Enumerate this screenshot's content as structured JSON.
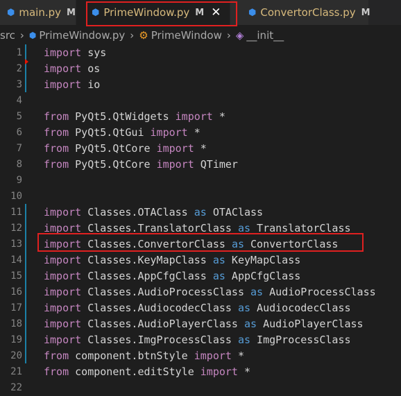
{
  "tabs": [
    {
      "name": "main.py",
      "badge": "M"
    },
    {
      "name": "PrimeWindow.py",
      "badge": "M",
      "close": "✕"
    },
    {
      "name": "ConvertorClass.py",
      "badge": "M"
    }
  ],
  "breadcrumb": {
    "folder": "src",
    "file": "PrimeWindow.py",
    "class_name": "PrimeWindow",
    "method": "__init__"
  },
  "colors": {
    "keyword_blue": "#569cd6",
    "keyword_purple": "#c586c0",
    "highlight_red": "#e02020"
  },
  "lines": [
    {
      "n": "1",
      "tokens": [
        [
          "kw2",
          "import"
        ],
        [
          "",
          " sys"
        ]
      ]
    },
    {
      "n": "2",
      "tokens": [
        [
          "kw2",
          "import"
        ],
        [
          "",
          " os"
        ]
      ]
    },
    {
      "n": "3",
      "tokens": [
        [
          "kw2",
          "import"
        ],
        [
          "",
          " io"
        ]
      ]
    },
    {
      "n": "4",
      "tokens": []
    },
    {
      "n": "5",
      "tokens": [
        [
          "kw2",
          "from"
        ],
        [
          "",
          " PyQt5.QtWidgets "
        ],
        [
          "kw2",
          "import"
        ],
        [
          "",
          " *"
        ]
      ]
    },
    {
      "n": "6",
      "tokens": [
        [
          "kw2",
          "from"
        ],
        [
          "",
          " PyQt5.QtGui "
        ],
        [
          "kw2",
          "import"
        ],
        [
          "",
          " *"
        ]
      ]
    },
    {
      "n": "7",
      "tokens": [
        [
          "kw2",
          "from"
        ],
        [
          "",
          " PyQt5.QtCore "
        ],
        [
          "kw2",
          "import"
        ],
        [
          "",
          " *"
        ]
      ]
    },
    {
      "n": "8",
      "tokens": [
        [
          "kw2",
          "from"
        ],
        [
          "",
          " PyQt5.QtCore "
        ],
        [
          "kw2",
          "import"
        ],
        [
          "",
          " QTimer"
        ]
      ]
    },
    {
      "n": "9",
      "tokens": []
    },
    {
      "n": "10",
      "tokens": []
    },
    {
      "n": "11",
      "tokens": [
        [
          "kw2",
          "import"
        ],
        [
          "",
          " Classes.OTAClass "
        ],
        [
          "kw",
          "as"
        ],
        [
          "",
          " OTAClass"
        ]
      ]
    },
    {
      "n": "12",
      "tokens": [
        [
          "kw2",
          "import"
        ],
        [
          "",
          " Classes.TranslatorClass "
        ],
        [
          "kw",
          "as"
        ],
        [
          "",
          " TranslatorClass"
        ]
      ]
    },
    {
      "n": "13",
      "tokens": [
        [
          "kw2",
          "import"
        ],
        [
          "",
          " Classes.ConvertorClass "
        ],
        [
          "kw",
          "as"
        ],
        [
          "",
          " ConvertorClass"
        ]
      ]
    },
    {
      "n": "14",
      "tokens": [
        [
          "kw2",
          "import"
        ],
        [
          "",
          " Classes.KeyMapClass "
        ],
        [
          "kw",
          "as"
        ],
        [
          "",
          " KeyMapClass"
        ]
      ]
    },
    {
      "n": "15",
      "tokens": [
        [
          "kw2",
          "import"
        ],
        [
          "",
          " Classes.AppCfgClass "
        ],
        [
          "kw",
          "as"
        ],
        [
          "",
          " AppCfgClass"
        ]
      ]
    },
    {
      "n": "16",
      "tokens": [
        [
          "kw2",
          "import"
        ],
        [
          "",
          " Classes.AudioProcessClass "
        ],
        [
          "kw",
          "as"
        ],
        [
          "",
          " AudioProcessClass"
        ]
      ]
    },
    {
      "n": "17",
      "tokens": [
        [
          "kw2",
          "import"
        ],
        [
          "",
          " Classes.AudiocodecClass "
        ],
        [
          "kw",
          "as"
        ],
        [
          "",
          " AudiocodecClass"
        ]
      ]
    },
    {
      "n": "18",
      "tokens": [
        [
          "kw2",
          "import"
        ],
        [
          "",
          " Classes.AudioPlayerClass "
        ],
        [
          "kw",
          "as"
        ],
        [
          "",
          " AudioPlayerClass"
        ]
      ]
    },
    {
      "n": "19",
      "tokens": [
        [
          "kw2",
          "import"
        ],
        [
          "",
          " Classes.ImgProcessClass "
        ],
        [
          "kw",
          "as"
        ],
        [
          "",
          " ImgProcessClass"
        ]
      ]
    },
    {
      "n": "20",
      "tokens": [
        [
          "kw2",
          "from"
        ],
        [
          "",
          " component.btnStyle "
        ],
        [
          "kw2",
          "import"
        ],
        [
          "",
          " *"
        ]
      ]
    },
    {
      "n": "21",
      "tokens": [
        [
          "kw2",
          "from"
        ],
        [
          "",
          " component.editStyle "
        ],
        [
          "kw2",
          "import"
        ],
        [
          "",
          " *"
        ]
      ]
    },
    {
      "n": "22",
      "tokens": []
    }
  ]
}
